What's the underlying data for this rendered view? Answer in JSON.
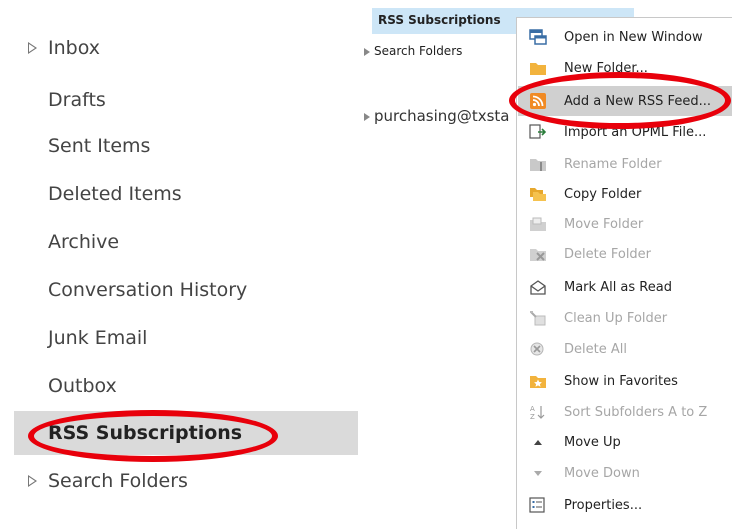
{
  "folders": [
    {
      "label": "Inbox",
      "expandable": true
    },
    {
      "label": "Drafts"
    },
    {
      "label": "Sent Items"
    },
    {
      "label": "Deleted Items"
    },
    {
      "label": "Archive"
    },
    {
      "label": "Conversation History"
    },
    {
      "label": "Junk Email"
    },
    {
      "label": "Outbox"
    },
    {
      "label": "RSS Subscriptions",
      "selected": true
    },
    {
      "label": "Search Folders",
      "expandable": true
    }
  ],
  "mid": {
    "selected_label": "RSS Subscriptions",
    "search_folders_label": "Search Folders",
    "account_label": "purchasing@txsta"
  },
  "menu": [
    {
      "label": "Open in New Window",
      "icon": "open-window-icon",
      "enabled": true
    },
    {
      "label": "New Folder...",
      "icon": "folder-icon",
      "enabled": true
    },
    {
      "label": "Add a New RSS Feed...",
      "icon": "rss-icon",
      "enabled": true,
      "highlighted": true
    },
    {
      "label": "Import an OPML File...",
      "icon": "import-icon",
      "enabled": true
    },
    {
      "label": "Rename Folder",
      "icon": "rename-folder-icon",
      "enabled": false
    },
    {
      "label": "Copy Folder",
      "icon": "copy-folder-icon",
      "enabled": true
    },
    {
      "label": "Move Folder",
      "icon": "move-folder-icon",
      "enabled": false
    },
    {
      "label": "Delete Folder",
      "icon": "delete-folder-icon",
      "enabled": false
    },
    {
      "label": "Mark All as Read",
      "icon": "mark-read-icon",
      "enabled": true
    },
    {
      "label": "Clean Up Folder",
      "icon": "clean-up-icon",
      "enabled": false
    },
    {
      "label": "Delete All",
      "icon": "delete-all-icon",
      "enabled": false
    },
    {
      "label": "Show in Favorites",
      "icon": "favorites-icon",
      "enabled": true
    },
    {
      "label": "Sort Subfolders A to Z",
      "icon": "sort-az-icon",
      "enabled": false
    },
    {
      "label": "Move Up",
      "icon": "arrow-up-icon",
      "enabled": true
    },
    {
      "label": "Move Down",
      "icon": "arrow-down-icon",
      "enabled": false
    },
    {
      "label": "Properties...",
      "icon": "properties-icon",
      "enabled": true
    }
  ],
  "colors": {
    "annotation": "#e8000b",
    "selection_gray": "#dadada",
    "selection_blue": "#cde6f7",
    "folder_yellow": "#f2b33d",
    "rss_orange": "#f08a24"
  }
}
